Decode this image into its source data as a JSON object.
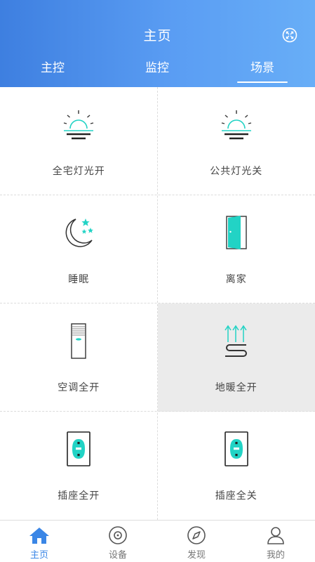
{
  "header": {
    "title": "主页",
    "tabs": [
      {
        "label": "主控",
        "active": false
      },
      {
        "label": "监控",
        "active": false
      },
      {
        "label": "场景",
        "active": true
      }
    ]
  },
  "scenes": [
    {
      "label": "全宅灯光开",
      "icon": "sunrise-light-on-icon"
    },
    {
      "label": "公共灯光关",
      "icon": "sunrise-light-off-icon"
    },
    {
      "label": "睡眠",
      "icon": "moon-stars-icon"
    },
    {
      "label": "离家",
      "icon": "door-icon"
    },
    {
      "label": "空调全开",
      "icon": "air-conditioner-icon"
    },
    {
      "label": "地暖全开",
      "icon": "floor-heating-icon",
      "selected": true
    },
    {
      "label": "插座全开",
      "icon": "socket-icon"
    },
    {
      "label": "插座全关",
      "icon": "socket-icon"
    }
  ],
  "bottom_nav": [
    {
      "label": "主页",
      "icon": "home-icon",
      "active": true
    },
    {
      "label": "设备",
      "icon": "device-icon",
      "active": false
    },
    {
      "label": "发现",
      "icon": "compass-icon",
      "active": false
    },
    {
      "label": "我的",
      "icon": "user-icon",
      "active": false
    }
  ],
  "colors": {
    "accent": "#3a86e6",
    "icon_teal": "#22d3c5",
    "header_start": "#3e7fe0",
    "header_end": "#68aef7"
  }
}
